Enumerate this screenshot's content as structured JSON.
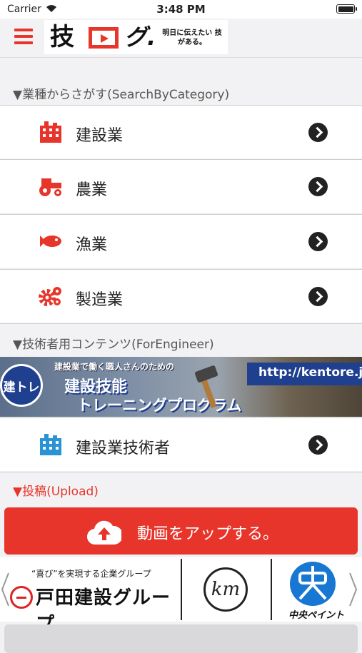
{
  "status_bar": {
    "carrier": "Carrier",
    "time": "3:48 PM"
  },
  "header": {
    "logo": {
      "kanji": "技",
      "gu": "グ.",
      "tagline": "明日に伝えたい 技がある。"
    }
  },
  "sections": {
    "search_by_category": "▼業種からさがす(SearchByCategory)",
    "for_engineer": "▼技術者用コンテンツ(ForEngineer)",
    "upload": "▼投稿(Upload)"
  },
  "categories": [
    {
      "label": "建設業",
      "icon": "building-icon",
      "color": "#e8352b"
    },
    {
      "label": "農業",
      "icon": "tractor-icon",
      "color": "#e8352b"
    },
    {
      "label": "漁業",
      "icon": "fish-icon",
      "color": "#e8352b"
    },
    {
      "label": "製造業",
      "icon": "gears-icon",
      "color": "#e8352b"
    }
  ],
  "banner": {
    "badge": "建トレ",
    "small_text": "建設業で働く職人さんのための",
    "line1": "建設技能",
    "line2": "トレーニングプログラム",
    "url": "http://kentore.jp/"
  },
  "engineer_row": {
    "label": "建設業技術者",
    "icon": "building-icon",
    "color": "#2a93d5"
  },
  "upload_button": {
    "label": "動画をアップする。",
    "icon": "cloud-upload-icon"
  },
  "sponsors": {
    "toda_small": "“喜び”を実現する企業グループ",
    "toda_big": "戸田建設グループ",
    "km": "km",
    "chuo": "中央ペイント"
  },
  "colors": {
    "accent": "#e8352b",
    "engineer_blue": "#2a93d5",
    "chevron": "#222222"
  }
}
